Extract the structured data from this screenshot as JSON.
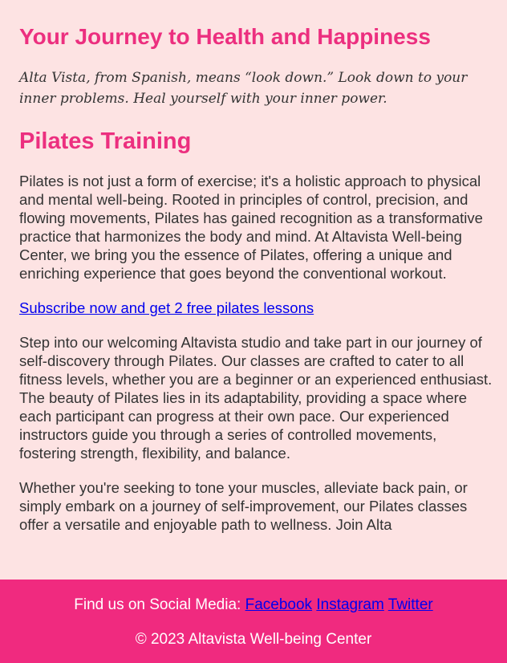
{
  "header": {
    "title": "Your Journey to Health and Happiness",
    "tagline": "Alta Vista, from Spanish, means “look down.” Look down to your inner problems. Heal yourself with your inner power."
  },
  "section": {
    "title": "Pilates Training",
    "paragraph1": "Pilates is not just a form of exercise; it's a holistic approach to physical and mental well-being. Rooted in principles of control, precision, and flowing movements, Pilates has gained recognition as a transformative practice that harmonizes the body and mind. At Altavista Well-being Center, we bring you the essence of Pilates, offering a unique and enriching experience that goes beyond the conventional workout.",
    "subscribe_link": "Subscribe now and get 2 free pilates lessons",
    "paragraph2": "Step into our welcoming Altavista studio and take part in our journey of self-discovery through Pilates. Our classes are crafted to cater to all fitness levels, whether you are a beginner or an experienced enthusiast. The beauty of Pilates lies in its adaptability, providing a space where each participant can progress at their own pace. Our experienced instructors guide you through a series of controlled movements, fostering strength, flexibility, and balance.",
    "paragraph3": "Whether you're seeking to tone your muscles, alleviate back pain, or simply embark on a journey of self-improvement, our Pilates classes offer a versatile and enjoyable path to wellness. Join Alta"
  },
  "footer": {
    "social_label": "Find us on Social Media:",
    "facebook": "Facebook",
    "instagram": "Instagram",
    "twitter": "Twitter",
    "copyright": "© 2023 Altavista Well-being Center"
  },
  "colors": {
    "background": "#fde3e3",
    "accent": "#ec2f7f",
    "footer_bg": "#f02a7f",
    "link": "#0000ee"
  }
}
